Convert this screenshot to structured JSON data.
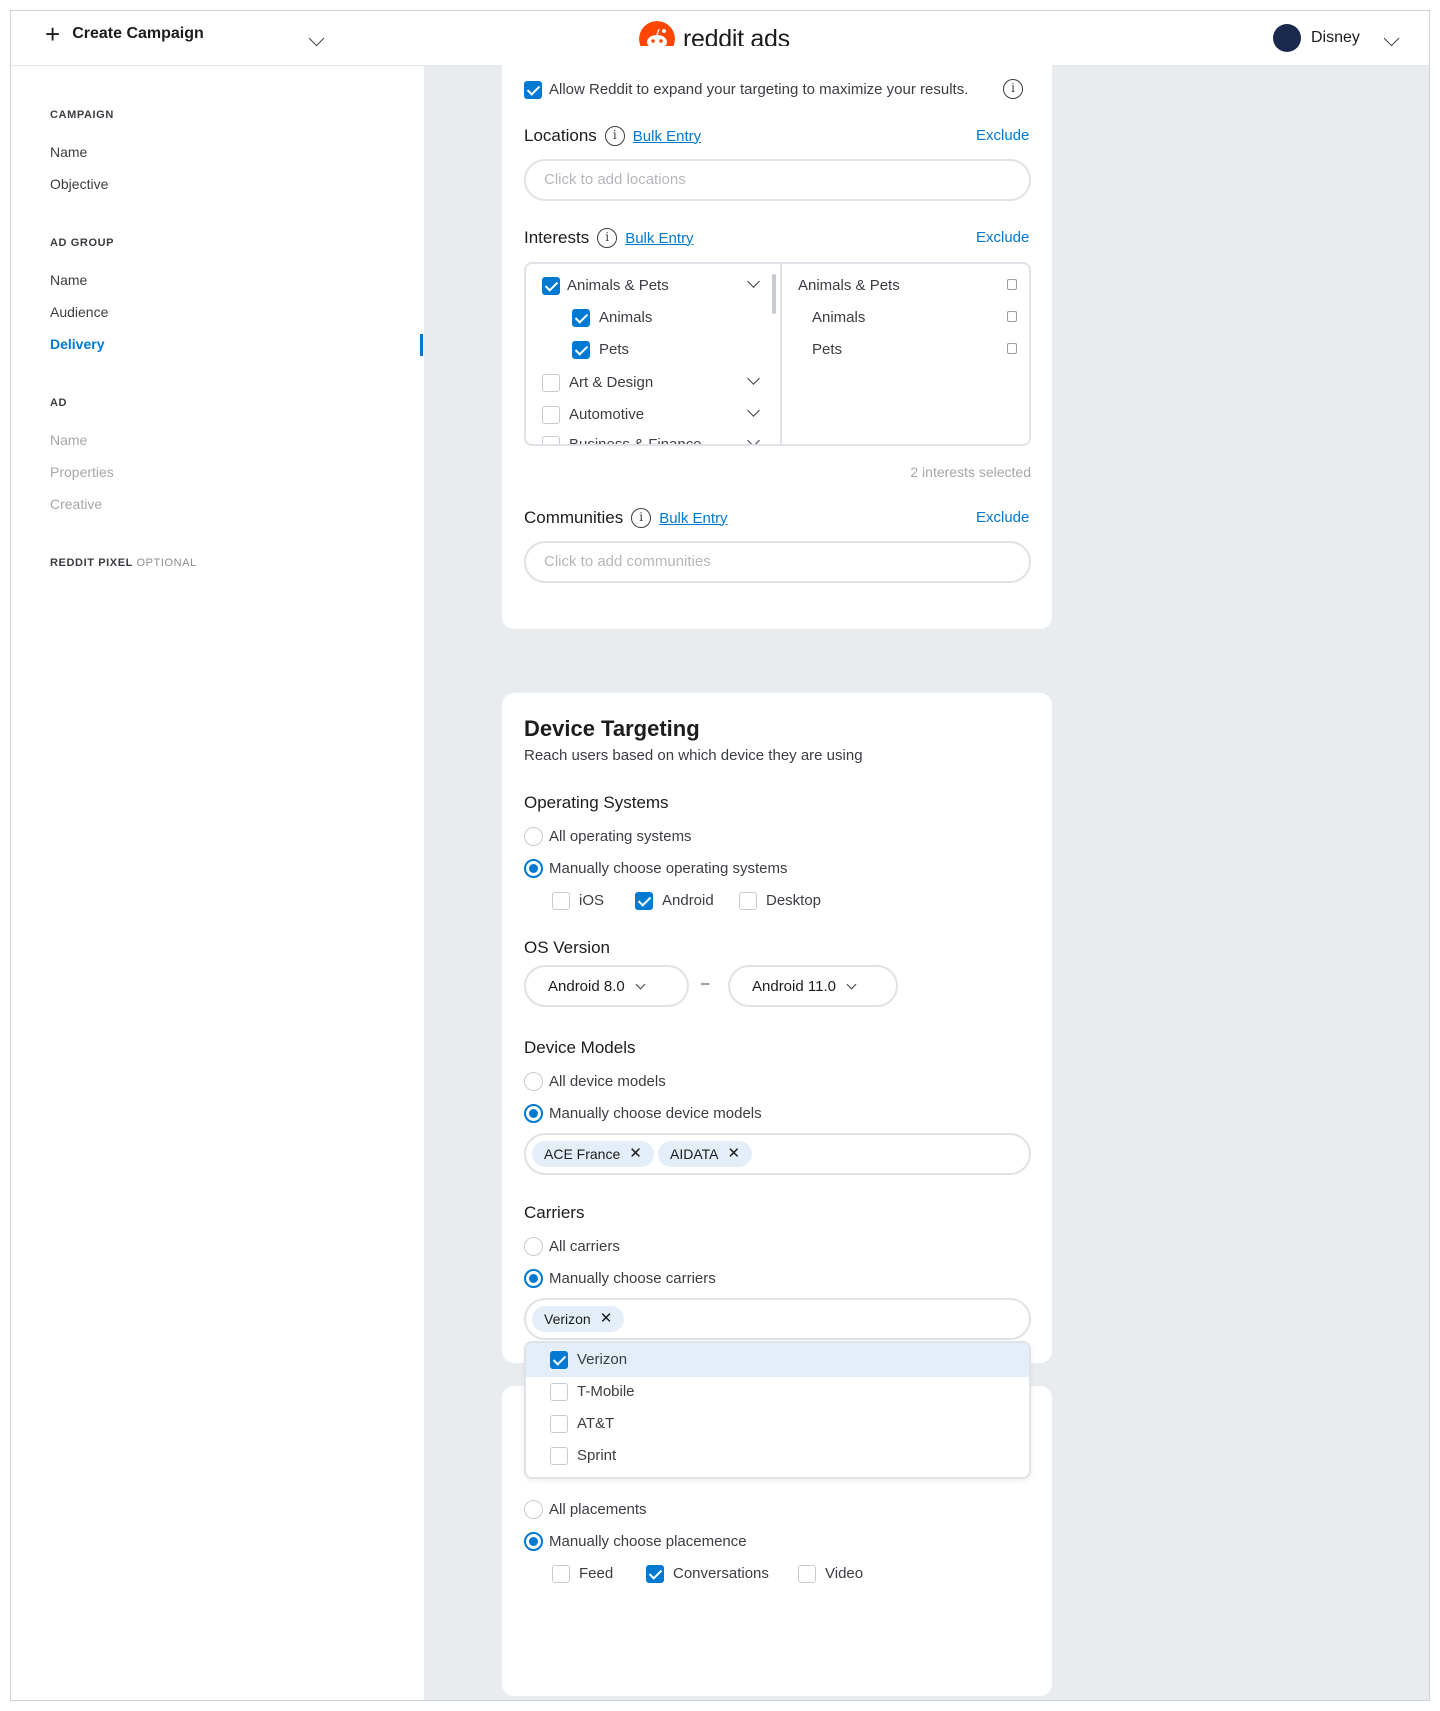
{
  "header": {
    "create_label": "Create Campaign",
    "logo_text": "reddit ads",
    "account_name": "Disney"
  },
  "sidebar": {
    "campaign_heading": "CAMPAIGN",
    "campaign_items": [
      "Name",
      "Objective"
    ],
    "adgroup_heading": "AD GROUP",
    "adgroup_items": [
      "Name",
      "Audience",
      "Delivery"
    ],
    "ad_heading": "AD",
    "ad_items": [
      "Name",
      "Properties",
      "Creative"
    ],
    "pixel_heading": "REDDIT PIXEL",
    "pixel_optional": "OPTIONAL"
  },
  "targeting": {
    "expand_label": "Allow Reddit to expand your targeting to maximize your results.",
    "expand_checked": true,
    "locations_label": "Locations",
    "bulk_entry": "Bulk Entry",
    "exclude": "Exclude",
    "locations_placeholder": "Click to add locations",
    "interests_label": "Interests",
    "interest_list": [
      {
        "label": "Animals & Pets",
        "checked": true,
        "expandable": true
      },
      {
        "label": "Animals",
        "checked": true,
        "expandable": false
      },
      {
        "label": "Pets",
        "checked": true,
        "expandable": false
      },
      {
        "label": "Art & Design",
        "checked": false,
        "expandable": true
      },
      {
        "label": "Automotive",
        "checked": false,
        "expandable": true
      },
      {
        "label": "Business & Finance",
        "checked": false,
        "expandable": true
      }
    ],
    "selected_interests": [
      "Animals & Pets",
      "Animals",
      "Pets"
    ],
    "interests_count": "2 interests selected",
    "communities_label": "Communities",
    "communities_placeholder": "Click to add communities"
  },
  "device": {
    "title": "Device Targeting",
    "subtitle": "Reach users based on which device they are using",
    "os_label": "Operating Systems",
    "os_all": "All operating systems",
    "os_manual": "Manually choose operating systems",
    "os_options": [
      {
        "label": "iOS",
        "checked": false
      },
      {
        "label": "Android",
        "checked": true
      },
      {
        "label": "Desktop",
        "checked": false
      }
    ],
    "os_version_label": "OS Version",
    "os_version_from": "Android 8.0",
    "os_version_sep": "–",
    "os_version_to": "Android 11.0",
    "models_label": "Device Models",
    "models_all": "All device models",
    "models_manual": "Manually choose device models",
    "model_chips": [
      "ACE France",
      "AIDATA"
    ],
    "carriers_label": "Carriers",
    "carriers_all": "All carriers",
    "carriers_manual": "Manually choose carriers",
    "carrier_chips": [
      "Verizon"
    ],
    "carrier_options": [
      {
        "label": "Verizon",
        "checked": true
      },
      {
        "label": "T-Mobile",
        "checked": false
      },
      {
        "label": "AT&T",
        "checked": false
      },
      {
        "label": "Sprint",
        "checked": false
      }
    ]
  },
  "placement": {
    "all": "All placements",
    "manual": "Manually choose placemence",
    "options": [
      {
        "label": "Feed",
        "checked": false
      },
      {
        "label": "Conversations",
        "checked": true
      },
      {
        "label": "Video",
        "checked": false
      }
    ]
  },
  "colors": {
    "accent": "#0079d3",
    "brand": "#ff4500",
    "canvas": "#e9ecef"
  }
}
